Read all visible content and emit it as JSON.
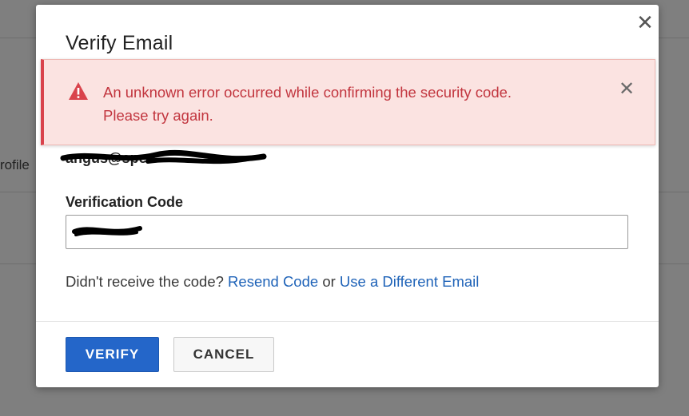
{
  "background": {
    "partial_text": "rofile"
  },
  "modal": {
    "title": "Verify Email",
    "close_glyph": "✕",
    "email_partial": "angus@spen",
    "field_label": "Verification Code",
    "code_value": "",
    "resend_prompt": "Didn't receive the code?",
    "resend_link": "Resend Code",
    "or_text": "or",
    "different_email_link": "Use a Different Email",
    "verify_button": "VERIFY",
    "cancel_button": "CANCEL"
  },
  "alert": {
    "icon": "warning-triangle-icon",
    "message_line1": "An unknown error occurred while confirming the security code.",
    "message_line2": "Please try again.",
    "close_glyph": "✕"
  },
  "colors": {
    "primary": "#2466c9",
    "link": "#1f63b8",
    "error_text": "#c2363f",
    "error_bg": "#fbe3e1",
    "error_border": "#d9434c"
  }
}
